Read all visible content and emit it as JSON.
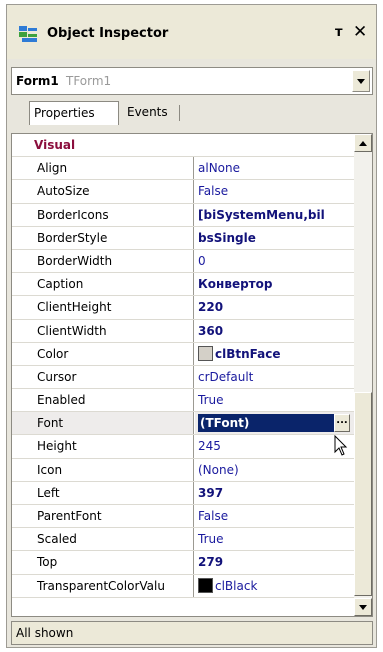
{
  "window": {
    "title": "Object Inspector",
    "pin_glyph": "т",
    "close_glyph": "✕"
  },
  "combo": {
    "name": "Form1",
    "type": "TForm1"
  },
  "tabs": [
    {
      "label": "Properties",
      "active": true
    },
    {
      "label": "Events",
      "active": false
    }
  ],
  "category": {
    "label": "Visual",
    "expanded": true
  },
  "properties": [
    {
      "name": "Align",
      "value": "alNone",
      "bold": false
    },
    {
      "name": "AutoSize",
      "value": "False",
      "bold": false
    },
    {
      "name": "BorderIcons",
      "value": "[biSystemMenu,bil",
      "bold": true,
      "expandable": true
    },
    {
      "name": "BorderStyle",
      "value": "bsSingle",
      "bold": true
    },
    {
      "name": "BorderWidth",
      "value": "0",
      "bold": false
    },
    {
      "name": "Caption",
      "value": "Конвертор",
      "bold": true
    },
    {
      "name": "ClientHeight",
      "value": "220",
      "bold": true
    },
    {
      "name": "ClientWidth",
      "value": "360",
      "bold": true
    },
    {
      "name": "Color",
      "value": "clBtnFace",
      "bold": true,
      "swatch": "#d4d0c8"
    },
    {
      "name": "Cursor",
      "value": "crDefault",
      "bold": false
    },
    {
      "name": "Enabled",
      "value": "True",
      "bold": false
    },
    {
      "name": "Font",
      "value": "(TFont)",
      "bold": true,
      "expandable": true,
      "selected": true
    },
    {
      "name": "Height",
      "value": "245",
      "bold": false
    },
    {
      "name": "Icon",
      "value": "(None)",
      "bold": false
    },
    {
      "name": "Left",
      "value": "397",
      "bold": true
    },
    {
      "name": "ParentFont",
      "value": "False",
      "bold": false
    },
    {
      "name": "Scaled",
      "value": "True",
      "bold": false
    },
    {
      "name": "Top",
      "value": "279",
      "bold": true
    },
    {
      "name": "TransparentColorValu",
      "value": "clBlack",
      "bold": false,
      "swatch": "#000000"
    }
  ],
  "status": {
    "text": "All shown"
  },
  "colors": {
    "category_text": "#8b0e3d",
    "value_text": "#1a1a9e",
    "selection": "#0a246a"
  }
}
